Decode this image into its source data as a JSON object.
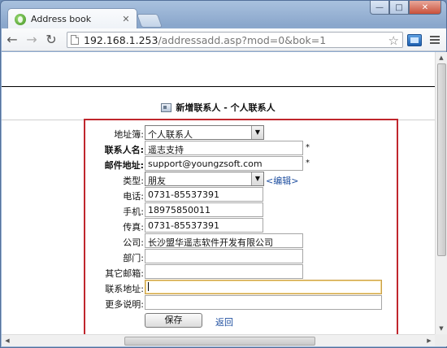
{
  "browser": {
    "tab_title": "Address book",
    "tab_close": "✕",
    "url_host": "192.168.1.253",
    "url_path": "/addressadd.asp?mod=0&bok=1",
    "controls": {
      "minimize": "—",
      "maximize": "□",
      "close": "✕"
    },
    "nav": {
      "back": "←",
      "forward": "→",
      "reload": "↻"
    }
  },
  "page": {
    "heading": "新增联系人 - 个人联系人"
  },
  "form": {
    "address_book": {
      "label": "地址簿:",
      "value": "个人联系人"
    },
    "contact_name": {
      "label": "联系人名:",
      "value": "遥志支持",
      "required": "*"
    },
    "email": {
      "label": "邮件地址:",
      "value": "support@youngzsoft.com",
      "required": "*"
    },
    "type": {
      "label": "类型:",
      "value": "朋友",
      "edit_link": "<编辑>"
    },
    "phone": {
      "label": "电话:",
      "value": "0731-85537391"
    },
    "mobile": {
      "label": "手机:",
      "value": "18975850011"
    },
    "fax": {
      "label": "传真:",
      "value": "0731-85537391"
    },
    "company": {
      "label": "公司:",
      "value": "长沙盟华遥志软件开发有限公司"
    },
    "department": {
      "label": "部门:",
      "value": ""
    },
    "other_email": {
      "label": "其它邮箱:",
      "value": ""
    },
    "address": {
      "label": "联系地址:",
      "value": ""
    },
    "notes": {
      "label": "更多说明:",
      "value": ""
    },
    "save_label": "保存",
    "back_label": "返回"
  },
  "colors": {
    "form_border": "#c0262d",
    "link": "#1f4fa0"
  }
}
